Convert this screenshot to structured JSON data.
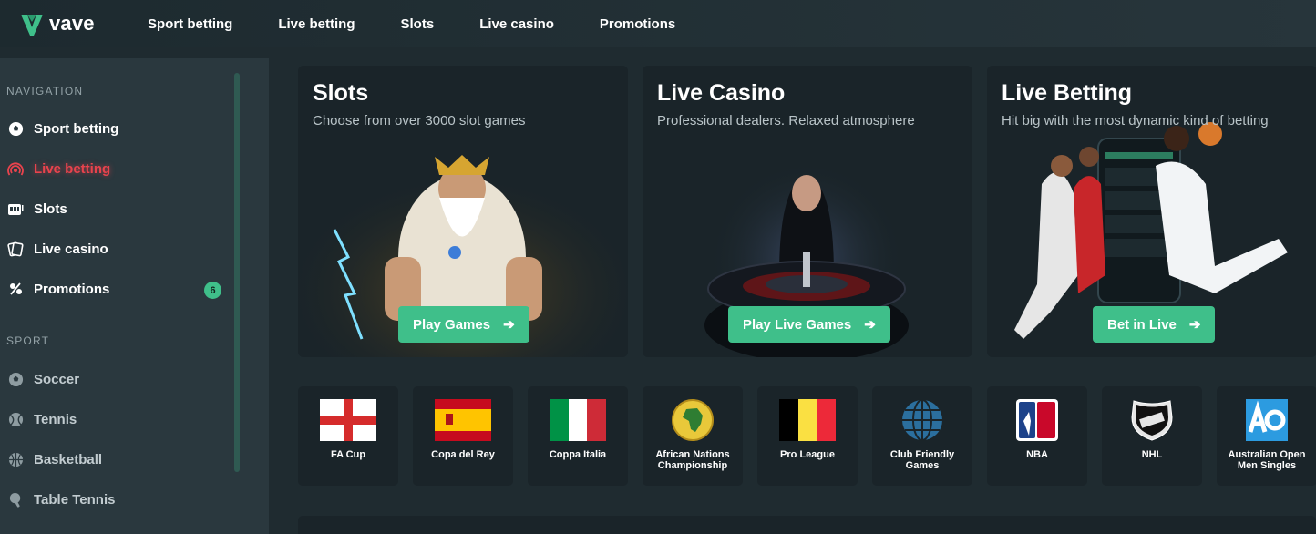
{
  "brand": {
    "name": "vave",
    "accent": "#3fbf8a",
    "live_color": "#e8434d"
  },
  "topnav": [
    "Sport betting",
    "Live betting",
    "Slots",
    "Live casino",
    "Promotions"
  ],
  "sidebar": {
    "navigation_label": "NAVIGATION",
    "nav": [
      {
        "label": "Sport betting",
        "icon": "soccer-ball-icon"
      },
      {
        "label": "Live betting",
        "icon": "live-signal-icon",
        "active": true
      },
      {
        "label": "Slots",
        "icon": "slot-machine-icon"
      },
      {
        "label": "Live casino",
        "icon": "cards-icon"
      },
      {
        "label": "Promotions",
        "icon": "promotions-icon",
        "badge": "6"
      }
    ],
    "sport_label": "SPORT",
    "sports": [
      {
        "label": "Soccer",
        "icon": "soccer-ball-icon"
      },
      {
        "label": "Tennis",
        "icon": "tennis-ball-icon"
      },
      {
        "label": "Basketball",
        "icon": "basketball-icon"
      },
      {
        "label": "Table Tennis",
        "icon": "table-tennis-icon"
      }
    ]
  },
  "promos": [
    {
      "title": "Slots",
      "subtitle": "Choose from over 3000 slot games",
      "cta": "Play Games"
    },
    {
      "title": "Live Casino",
      "subtitle": "Professional dealers. Relaxed atmosphere",
      "cta": "Play Live Games"
    },
    {
      "title": "Live Betting",
      "subtitle": "Hit big with the most dynamic kind of betting",
      "cta": "Bet in Live"
    }
  ],
  "competitions": [
    {
      "name": "FA Cup",
      "icon": "england-flag-icon"
    },
    {
      "name": "Copa del Rey",
      "icon": "spain-flag-icon"
    },
    {
      "name": "Coppa Italia",
      "icon": "italy-flag-icon"
    },
    {
      "name": "African Nations Championship",
      "icon": "africa-globe-icon"
    },
    {
      "name": "Pro League",
      "icon": "belgium-flag-icon"
    },
    {
      "name": "Club Friendly Games",
      "icon": "world-globe-icon"
    },
    {
      "name": "NBA",
      "icon": "nba-logo-icon"
    },
    {
      "name": "NHL",
      "icon": "nhl-logo-icon"
    },
    {
      "name": "Australian Open Men Singles",
      "icon": "australian-open-logo-icon"
    }
  ]
}
